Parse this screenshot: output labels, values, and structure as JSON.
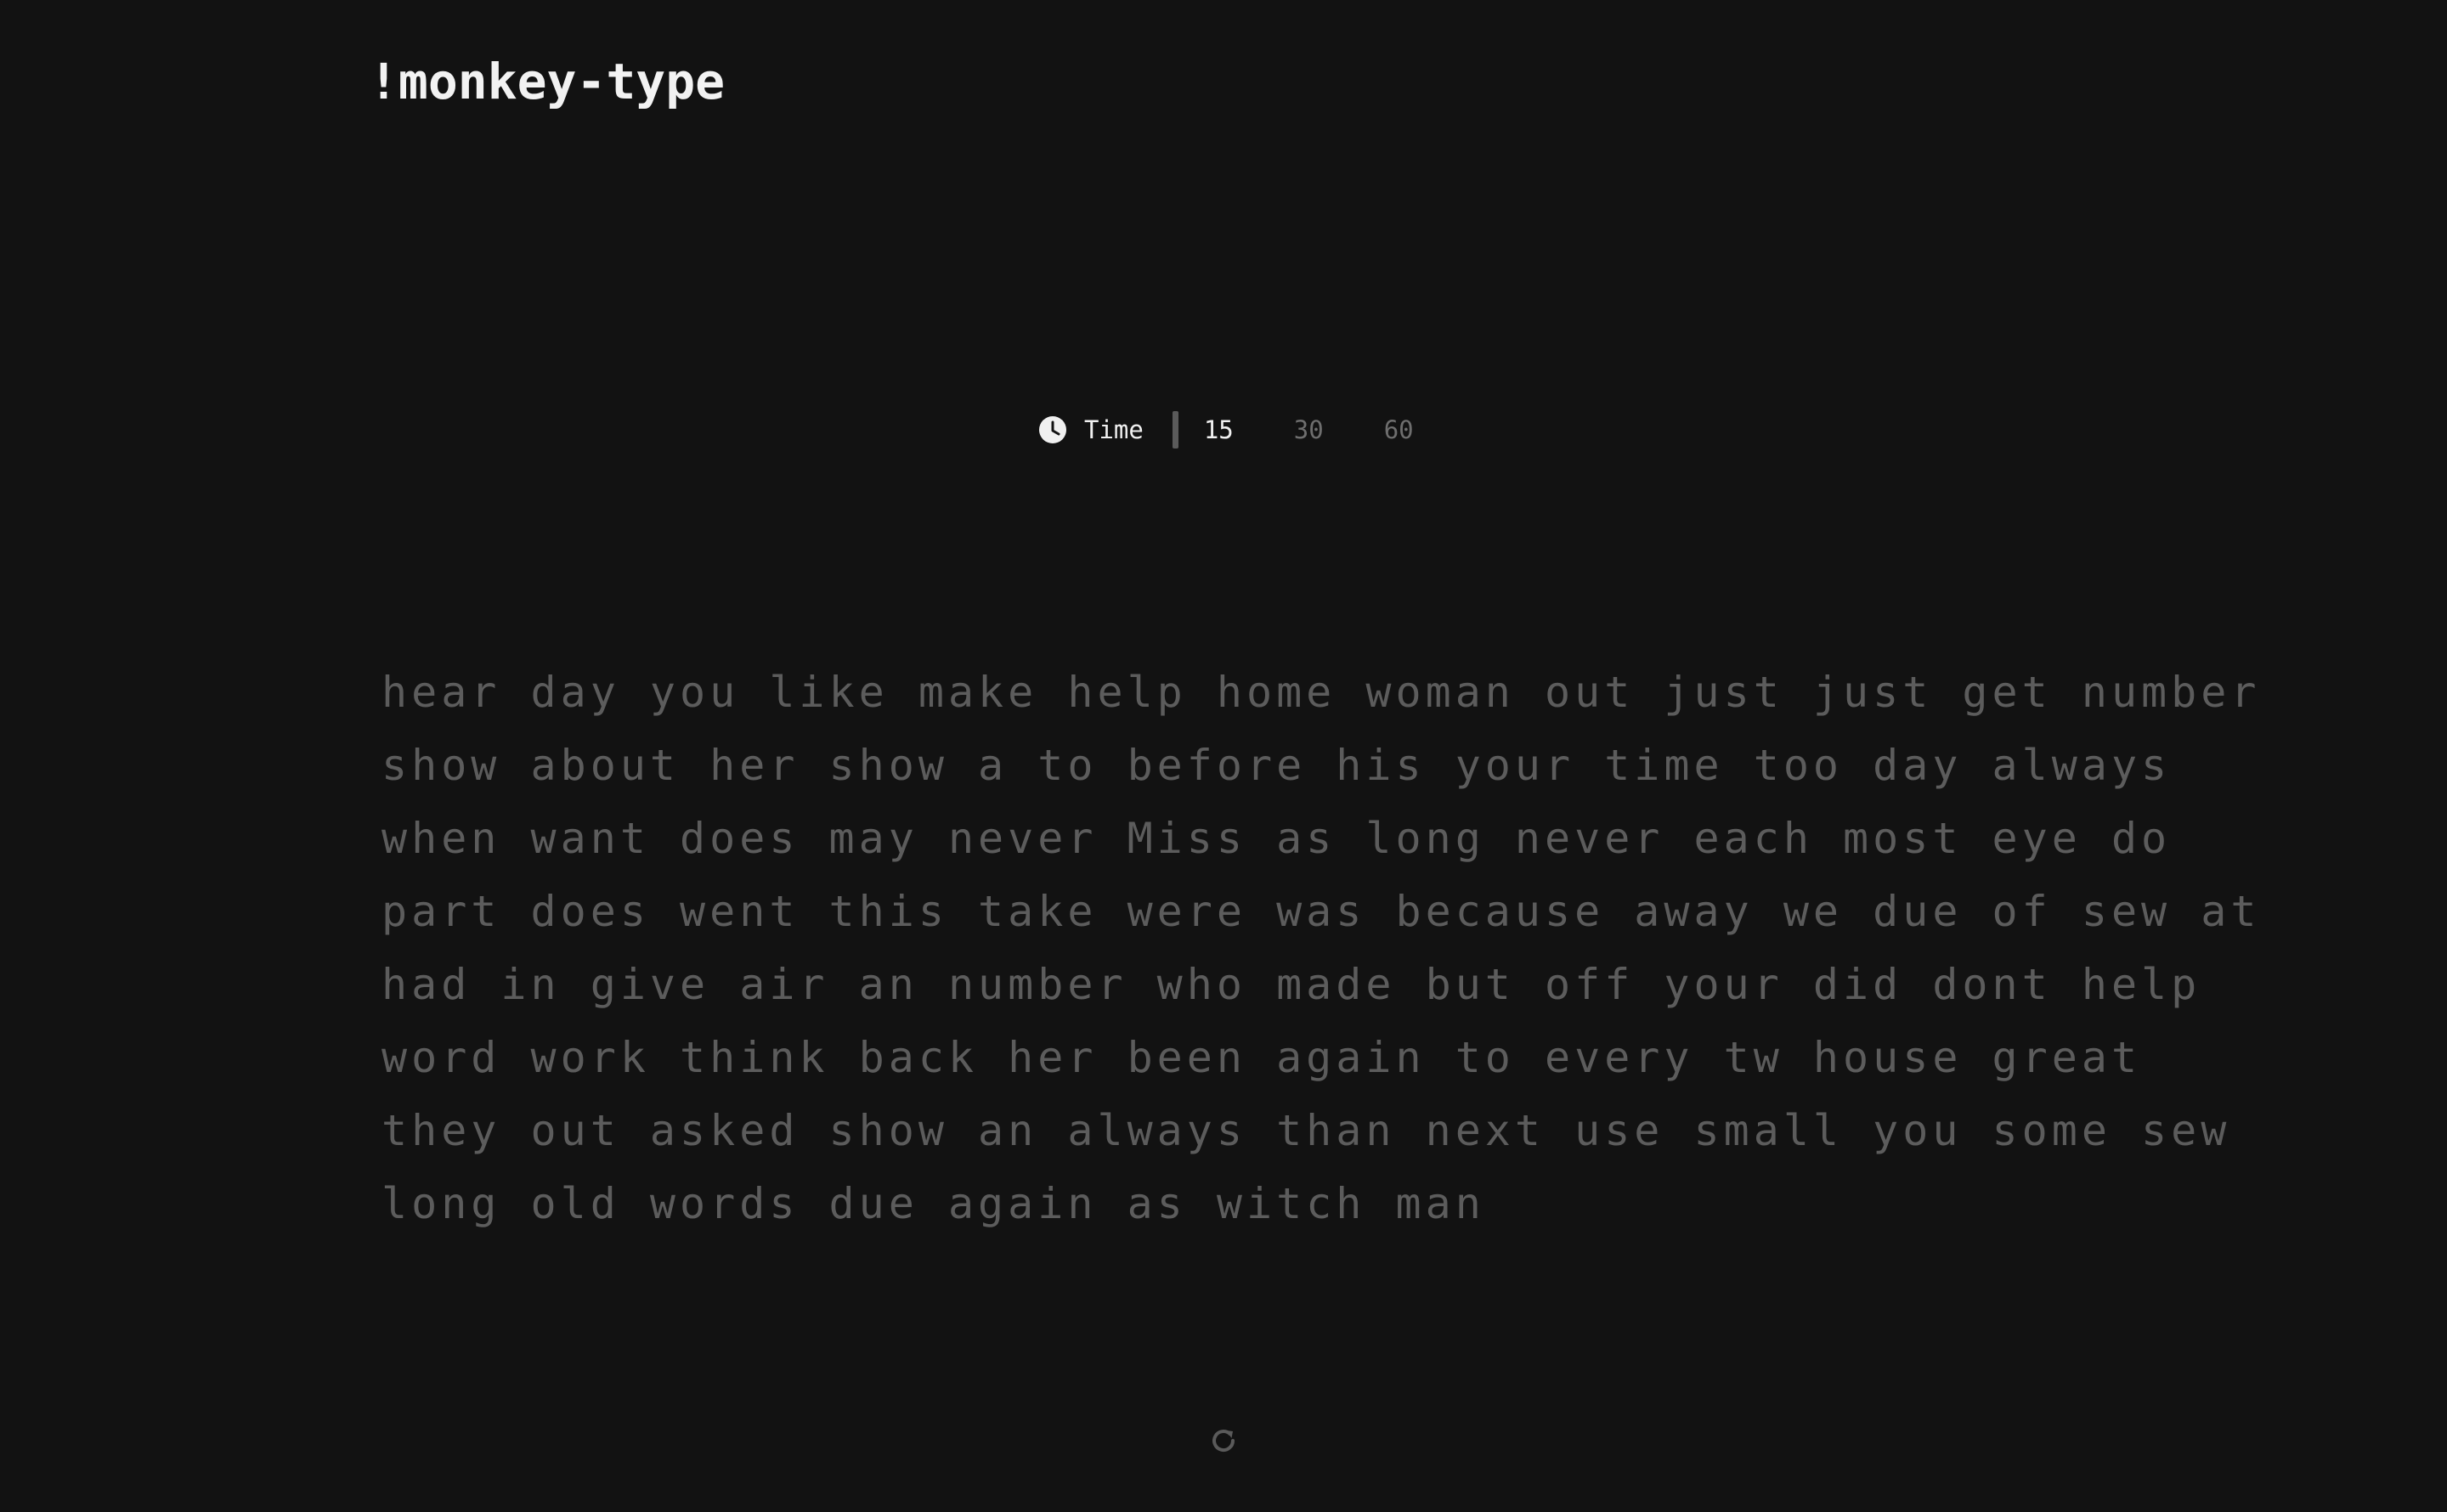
{
  "app": {
    "logo": "!monkey-type"
  },
  "mode": {
    "icon": "clock-icon",
    "label": "Time",
    "durations": [
      "15",
      "30",
      "60"
    ],
    "selected": "15"
  },
  "words": {
    "lines": [
      "hear day you like make help home woman out just just get number",
      "show about her show a to before his your time too day always",
      "when want does may never Miss as long never each most eye do",
      "part does went this take were was because away we due of sew at",
      "had in give air an number who made but off your did dont help",
      "word work think back her been again to every tw house great",
      "they out asked show an always than next use small you some sew",
      "long old words due again as witch man"
    ]
  },
  "controls": {
    "restart_icon": "restart-icon"
  },
  "colors": {
    "background": "#121212",
    "text_active": "#f0f0f0",
    "text_inactive": "#5c5c5c"
  }
}
